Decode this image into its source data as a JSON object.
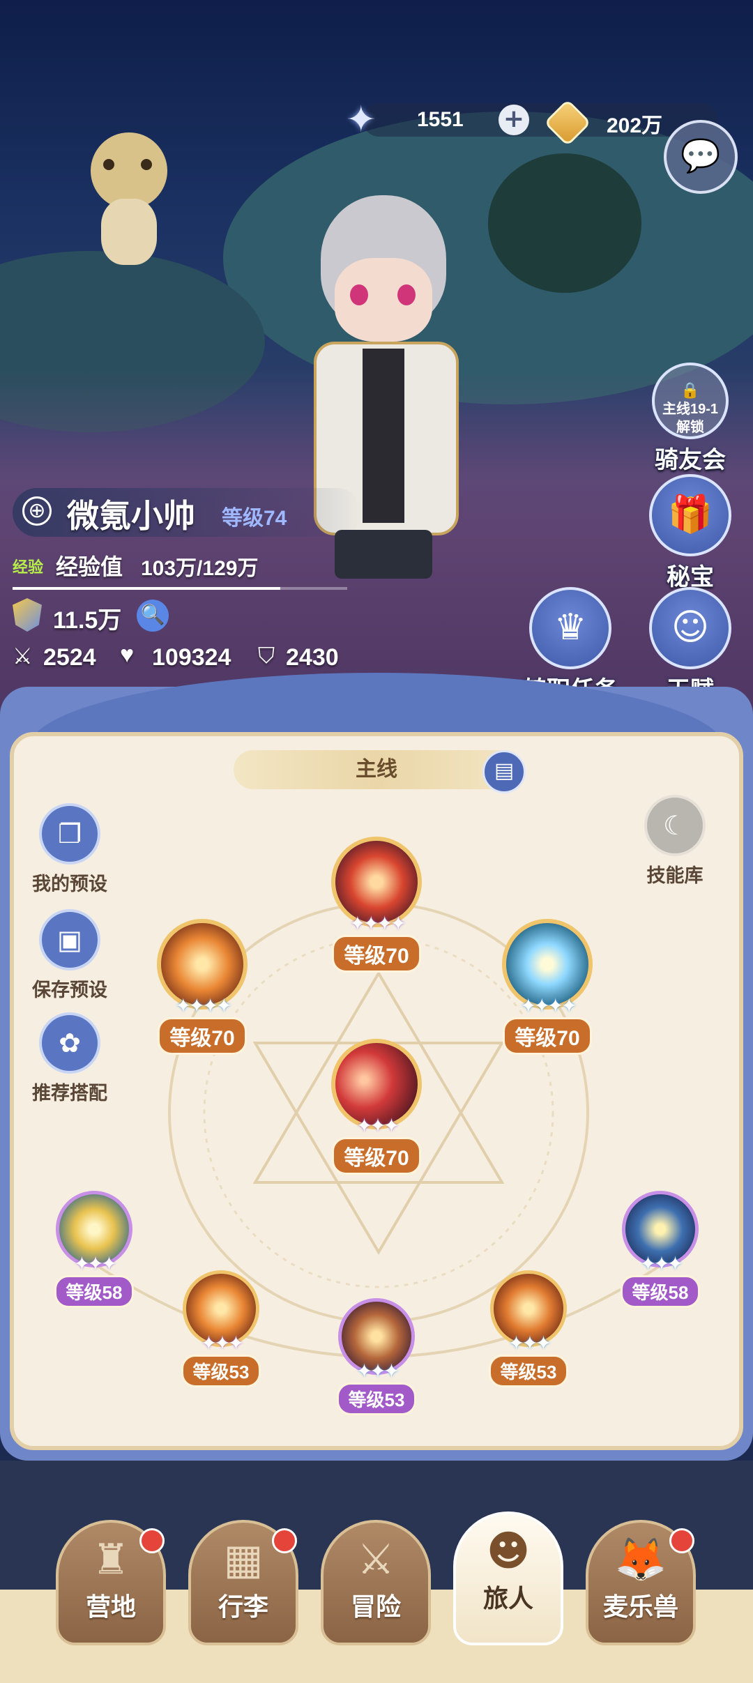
{
  "currency": {
    "stars": "1551",
    "coins": "202万"
  },
  "profile": {
    "name": "微氪小帅",
    "level": "等级74",
    "exp_tag": "经验",
    "exp_label": "经验值",
    "exp_value": "103万/129万",
    "power": "11.5万",
    "attack": "2524",
    "hp": "109324",
    "defense": "2430"
  },
  "features": {
    "rider_lock_line1": "主线19-1",
    "rider_lock_line2": "解锁",
    "rider_label": "骑友会",
    "treasure_label": "秘宝",
    "job_quest_label": "转职任务",
    "talent_label": "天赋"
  },
  "panel": {
    "tab": "主线",
    "skill_library": "技能库",
    "side": {
      "my_preset": "我的预设",
      "save_preset": "保存预设",
      "recommend": "推荐搭配"
    },
    "skills": {
      "top": "等级70",
      "left": "等级70",
      "right": "等级70",
      "center": "等级70",
      "p1": "等级58",
      "p2": "等级53",
      "p3": "等级53",
      "p4": "等级53",
      "p5": "等级58"
    }
  },
  "nav": {
    "camp": "营地",
    "luggage": "行李",
    "adventure": "冒险",
    "traveler": "旅人",
    "pets": "麦乐兽"
  },
  "colors": {
    "panel_bg": "#f6efe1",
    "accent_blue": "#5a76c2",
    "level_orange": "#c86e2a",
    "level_purple": "#a25ac8"
  }
}
